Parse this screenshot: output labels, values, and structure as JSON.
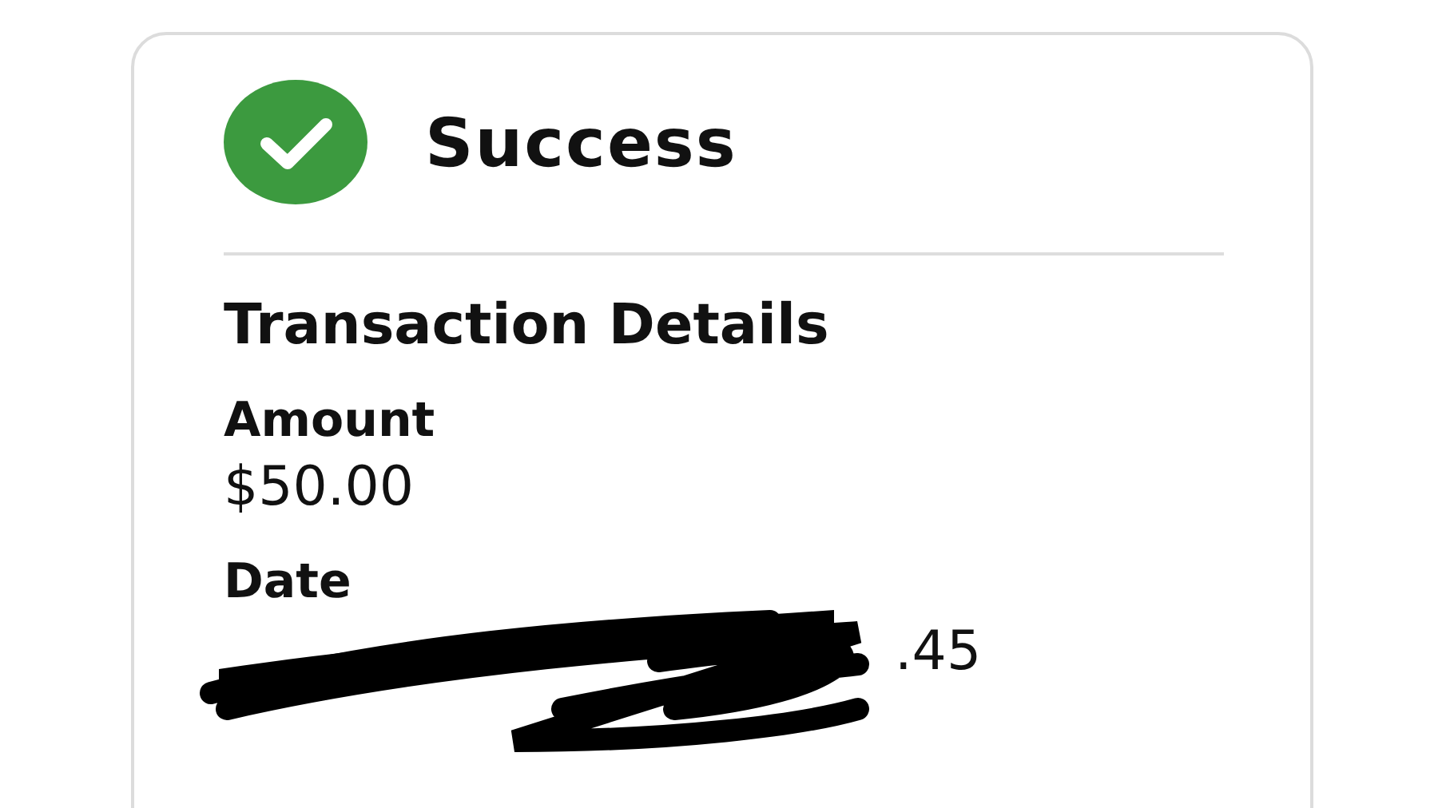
{
  "status": {
    "title": "Success"
  },
  "details": {
    "heading": "Transaction Details",
    "fields": [
      {
        "label": "Amount",
        "value": "$50.00"
      },
      {
        "label": "Date",
        "value": ".45",
        "redacted": true
      }
    ]
  }
}
